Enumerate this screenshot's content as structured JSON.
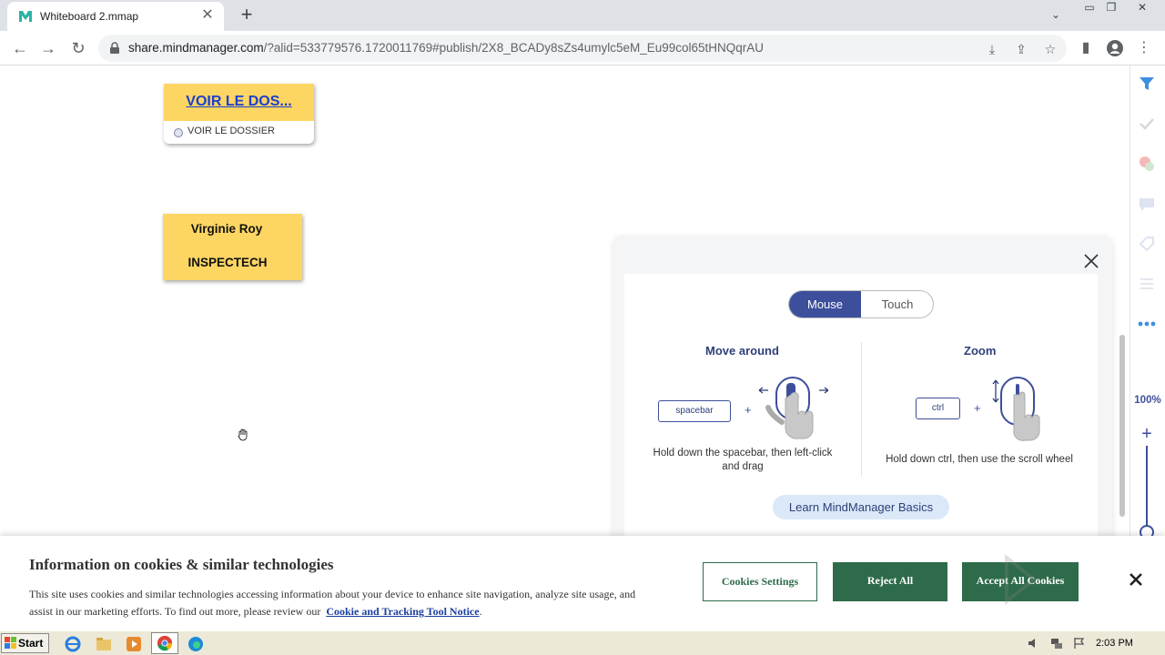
{
  "browser": {
    "tab_title": "Whiteboard 2.mmap",
    "url_host": "share.mindmanager.com",
    "url_rest": "/?alid=533779576.1720011769#publish/2X8_BCADy8sZs4umylc5eM_Eu99col65tHNQqrAU"
  },
  "canvas": {
    "topic1": {
      "title": "VOIR LE DOS...",
      "subtopic": "VOIR LE DOSSIER"
    },
    "topic2": {
      "line1": "Virginie Roy",
      "line2": "INSPECTECH"
    }
  },
  "help": {
    "tabs": [
      "Mouse",
      "Touch"
    ],
    "active_tab": "Mouse",
    "move": {
      "title": "Move around",
      "key": "spacebar",
      "plus": "+",
      "desc": "Hold down the spacebar, then left-click and drag"
    },
    "zoom": {
      "title": "Zoom",
      "key": "ctrl",
      "plus": "+",
      "desc": "Hold down ctrl, then use the scroll wheel"
    },
    "learn_label": "Learn MindManager Basics"
  },
  "sidebar": {
    "zoom_level": "100%"
  },
  "cookie": {
    "title": "Information on cookies & similar technologies",
    "body": "This site uses cookies and similar technologies accessing information about your device to enhance site navigation, analyze site usage, and assist in our marketing efforts. To find out more, please review our",
    "link": "Cookie and Tracking Tool Notice",
    "settings_label": "Cookies Settings",
    "reject_label": "Reject All",
    "accept_label": "Accept All Cookies"
  },
  "taskbar": {
    "start_label": "Start",
    "clock": "2:03 PM"
  },
  "colors": {
    "accent": "#3d4f9b",
    "topic_fill": "#fdd562",
    "cookie_green": "#2d6b4a",
    "link_blue": "#1a3fd1"
  }
}
